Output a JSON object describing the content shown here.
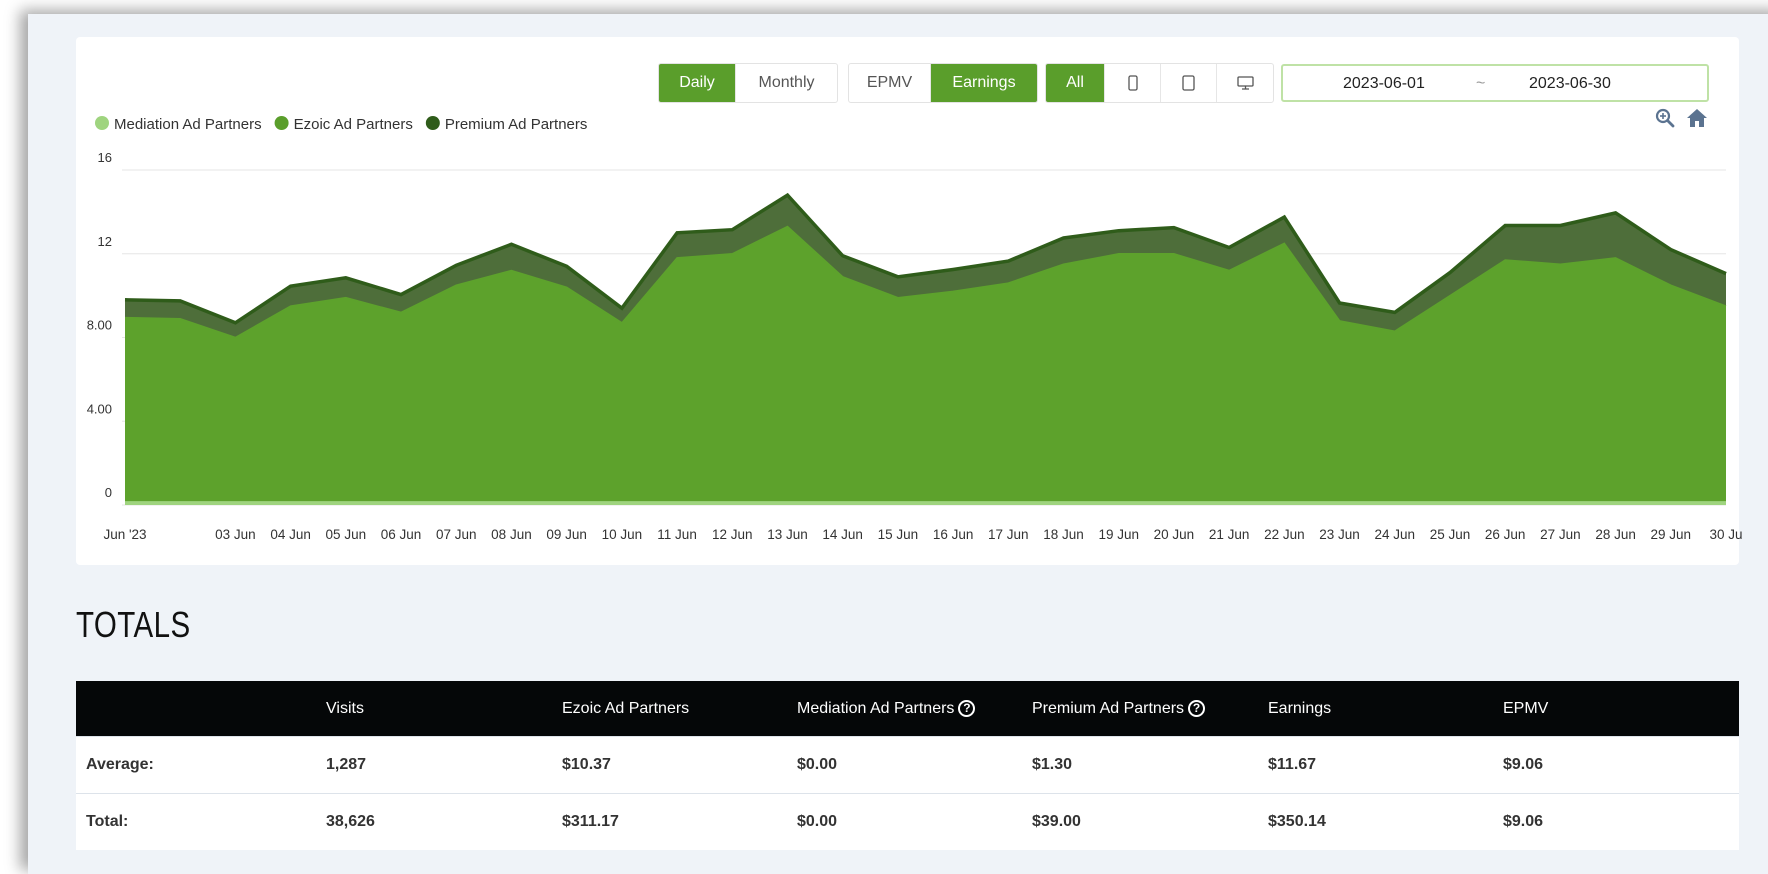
{
  "toolbar": {
    "period": {
      "daily": "Daily",
      "monthly": "Monthly",
      "active": "daily"
    },
    "metric": {
      "epmv": "EPMV",
      "earnings": "Earnings",
      "active": "earnings"
    },
    "device": {
      "all": "All",
      "icons": [
        "mobile-icon",
        "tablet-icon",
        "desktop-icon"
      ],
      "active": "all"
    },
    "date_range": {
      "start": "2023-06-01",
      "separator": "~",
      "end": "2023-06-30"
    }
  },
  "chart_actions": {
    "zoom_icon": "zoom-icon",
    "home_icon": "home-icon"
  },
  "colors": {
    "accent": "#5a9e2b",
    "mediation": "#9fd47f",
    "ezoic": "#5a9e2b",
    "premium": "#3f6a2a"
  },
  "chart_data": {
    "type": "area",
    "stacked": true,
    "legend": [
      {
        "name": "Mediation Ad Partners",
        "color": "#9fd47f"
      },
      {
        "name": "Ezoic Ad Partners",
        "color": "#5a9e2b"
      },
      {
        "name": "Premium Ad Partners",
        "color": "#2f5c1a"
      }
    ],
    "legend_position": "top-left",
    "ylim": [
      0,
      16
    ],
    "y_ticks": [
      "0",
      "4.00",
      "8.00",
      "12",
      "16"
    ],
    "y_tick_values": [
      0,
      4,
      8,
      12,
      16
    ],
    "grid": true,
    "x_labels": [
      "Jun '23",
      "03 Jun",
      "04 Jun",
      "05 Jun",
      "06 Jun",
      "07 Jun",
      "08 Jun",
      "09 Jun",
      "10 Jun",
      "11 Jun",
      "12 Jun",
      "13 Jun",
      "14 Jun",
      "15 Jun",
      "16 Jun",
      "17 Jun",
      "18 Jun",
      "19 Jun",
      "20 Jun",
      "21 Jun",
      "22 Jun",
      "23 Jun",
      "24 Jun",
      "25 Jun",
      "26 Jun",
      "27 Jun",
      "28 Jun",
      "29 Jun",
      "30 Ju"
    ],
    "x_label_days": [
      1,
      3,
      4,
      5,
      6,
      7,
      8,
      9,
      10,
      11,
      12,
      13,
      14,
      15,
      16,
      17,
      18,
      19,
      20,
      21,
      22,
      23,
      24,
      25,
      26,
      27,
      28,
      29,
      30
    ],
    "x": [
      "2023-06-01",
      "2023-06-02",
      "2023-06-03",
      "2023-06-04",
      "2023-06-05",
      "2023-06-06",
      "2023-06-07",
      "2023-06-08",
      "2023-06-09",
      "2023-06-10",
      "2023-06-11",
      "2023-06-12",
      "2023-06-13",
      "2023-06-14",
      "2023-06-15",
      "2023-06-16",
      "2023-06-17",
      "2023-06-18",
      "2023-06-19",
      "2023-06-20",
      "2023-06-21",
      "2023-06-22",
      "2023-06-23",
      "2023-06-24",
      "2023-06-25",
      "2023-06-26",
      "2023-06-27",
      "2023-06-28",
      "2023-06-29",
      "2023-06-30"
    ],
    "series": [
      {
        "name": "Mediation Ad Partners",
        "values": [
          0.15,
          0.15,
          0.15,
          0.15,
          0.15,
          0.15,
          0.15,
          0.15,
          0.15,
          0.15,
          0.15,
          0.15,
          0.15,
          0.15,
          0.15,
          0.15,
          0.15,
          0.15,
          0.15,
          0.15,
          0.15,
          0.15,
          0.15,
          0.15,
          0.15,
          0.15,
          0.15,
          0.15,
          0.15,
          0.15
        ]
      },
      {
        "name": "Ezoic Ad Partners",
        "values": [
          8.8,
          8.75,
          7.85,
          9.35,
          9.75,
          9.05,
          10.35,
          11.05,
          10.25,
          8.55,
          11.65,
          11.85,
          13.15,
          10.75,
          9.75,
          10.05,
          10.45,
          11.35,
          11.85,
          11.85,
          11.05,
          12.35,
          8.65,
          8.15,
          9.85,
          11.55,
          11.35,
          11.65,
          10.35,
          9.35
        ]
      },
      {
        "name": "Premium Ad Partners",
        "values": [
          0.85,
          0.85,
          0.7,
          0.95,
          0.95,
          0.85,
          0.95,
          1.25,
          1.0,
          0.7,
          1.2,
          1.15,
          1.5,
          1.0,
          1.0,
          1.05,
          1.05,
          1.25,
          1.1,
          1.25,
          1.1,
          1.25,
          0.85,
          0.9,
          1.1,
          1.65,
          1.85,
          2.15,
          1.7,
          1.55
        ]
      }
    ]
  },
  "totals": {
    "title": "TOTALS",
    "columns": [
      "",
      "Visits",
      "Ezoic Ad Partners",
      "Mediation Ad Partners",
      "Premium Ad Partners",
      "Earnings",
      "EPMV"
    ],
    "rows": [
      [
        "Average:",
        "1,287",
        "$10.37",
        "$0.00",
        "$1.30",
        "$11.67",
        "$9.06"
      ],
      [
        "Total:",
        "38,626",
        "$311.17",
        "$0.00",
        "$39.00",
        "$350.14",
        "$9.06"
      ]
    ]
  }
}
